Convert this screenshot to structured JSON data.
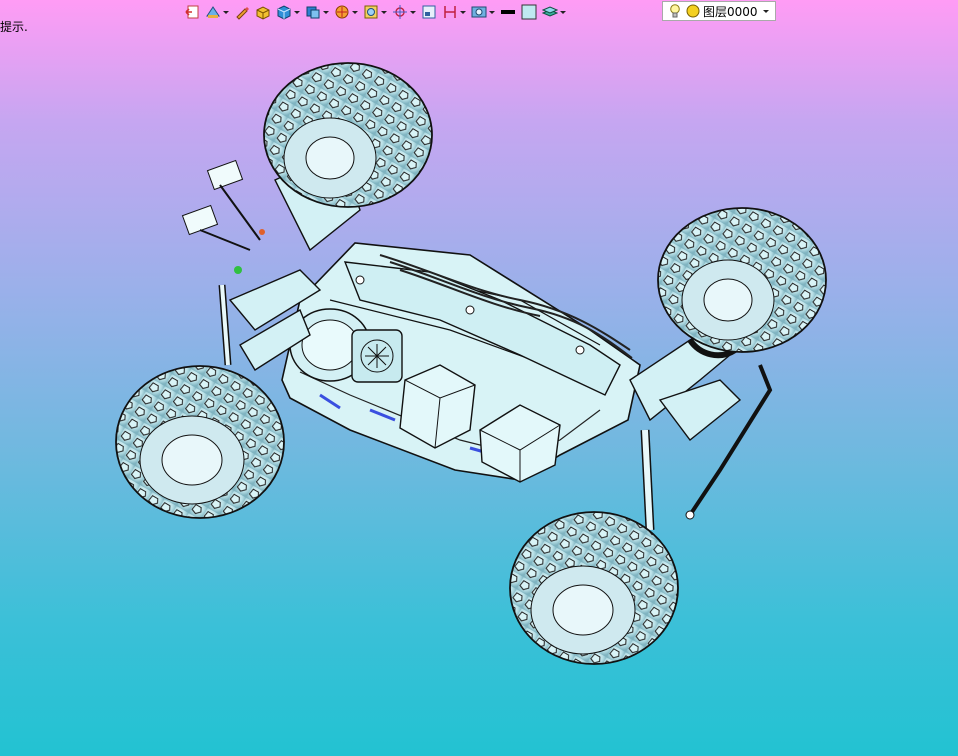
{
  "hint_text": "提示.",
  "toolbar": {
    "layer_name": "图层0000"
  },
  "colors": {
    "bg_top": "#ff9cf5",
    "bg_bottom": "#22c2d2",
    "model_fill": "#cdeff2",
    "model_edge": "#111111"
  }
}
